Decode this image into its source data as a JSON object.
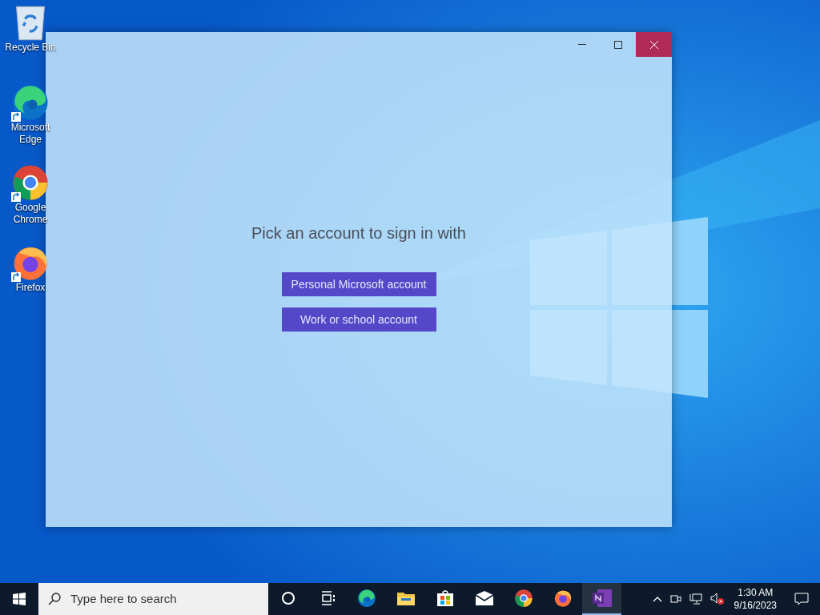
{
  "desktop_icons": [
    {
      "kind": "recycle",
      "label": "Recycle Bin",
      "shortcut": false
    },
    {
      "kind": "edge",
      "label": "Microsoft Edge",
      "shortcut": true
    },
    {
      "kind": "chrome",
      "label": "Google Chrome",
      "shortcut": true
    },
    {
      "kind": "firefox",
      "label": "Firefox",
      "shortcut": true
    }
  ],
  "window": {
    "close_hovered": true,
    "heading": "Pick an account to sign in with",
    "buttons": [
      "Personal Microsoft account",
      "Work or school account"
    ]
  },
  "taskbar": {
    "search": {
      "placeholder": "Type here to search"
    },
    "apps": [
      {
        "kind": "cortana",
        "active": false
      },
      {
        "kind": "taskview",
        "active": false
      },
      {
        "kind": "edge",
        "active": false
      },
      {
        "kind": "explorer",
        "active": false
      },
      {
        "kind": "store",
        "active": false
      },
      {
        "kind": "mail",
        "active": false
      },
      {
        "kind": "chrome",
        "active": false
      },
      {
        "kind": "firefox",
        "active": false
      },
      {
        "kind": "onenote",
        "active": true
      }
    ],
    "time": "1:30 AM",
    "date": "9/16/2023"
  }
}
